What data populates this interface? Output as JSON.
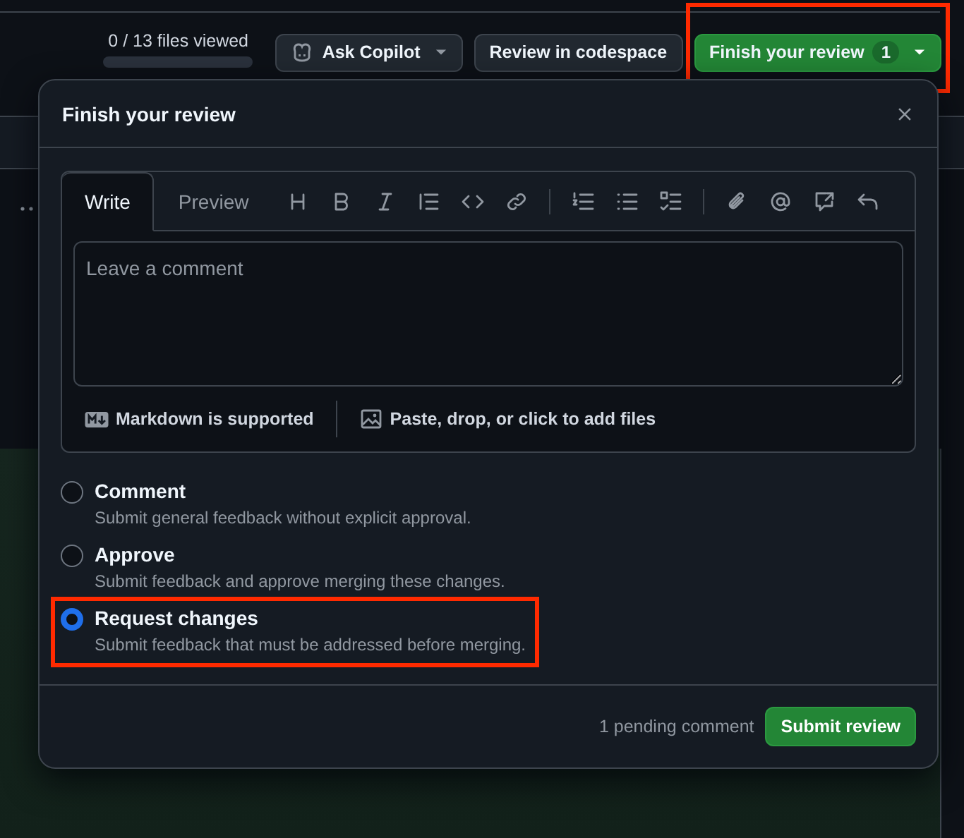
{
  "header": {
    "progress": {
      "text": "0 / 13 files viewed"
    },
    "buttons": [
      {
        "kind": "copilot",
        "label": "Ask Copilot",
        "highlighted": false
      },
      {
        "kind": "plain",
        "label": "Review in codespace",
        "highlighted": false
      },
      {
        "kind": "primary",
        "label": "Finish your review",
        "count": "1",
        "highlighted": true
      }
    ]
  },
  "dialog": {
    "title": "Finish your review",
    "tabs": [
      {
        "label": "Write",
        "selected": true
      },
      {
        "label": "Preview",
        "selected": false
      }
    ],
    "comment": {
      "placeholder": "Leave a comment"
    },
    "markdown_note": "Markdown is supported",
    "attach_note": "Paste, drop, or click to add files",
    "options": [
      {
        "label": "Comment",
        "description": "Submit general feedback without explicit approval.",
        "selected": false,
        "highlighted": false
      },
      {
        "label": "Approve",
        "description": "Submit feedback and approve merging these changes.",
        "selected": false,
        "highlighted": false
      },
      {
        "label": "Request changes",
        "description": "Submit feedback that must be addressed before merging.",
        "selected": true,
        "highlighted": true
      }
    ],
    "pending": "1 pending comment",
    "submit": "Submit review"
  }
}
